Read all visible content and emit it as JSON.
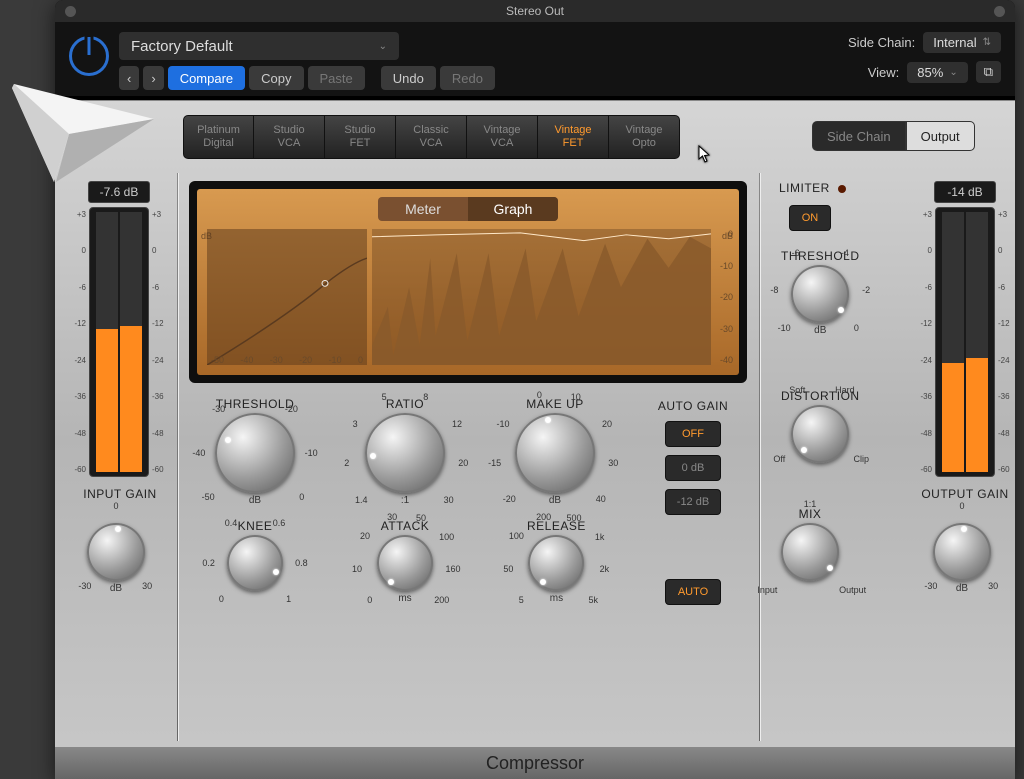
{
  "window": {
    "title": "Stereo Out"
  },
  "toolbar": {
    "preset": "Factory Default",
    "prev": "‹",
    "next": "›",
    "compare": "Compare",
    "copy": "Copy",
    "paste": "Paste",
    "undo": "Undo",
    "redo": "Redo",
    "sidechain_label": "Side Chain:",
    "sidechain_value": "Internal",
    "view_label": "View:",
    "view_value": "85%"
  },
  "model_tabs": [
    "Platinum Digital",
    "Studio VCA",
    "Studio FET",
    "Classic VCA",
    "Vintage VCA",
    "Vintage FET",
    "Vintage Opto"
  ],
  "model_active_index": 5,
  "panel_tabs": {
    "sidechain": "Side Chain",
    "output": "Output"
  },
  "input": {
    "value": "-7.6 dB",
    "marks": [
      "+3",
      "0",
      "-6",
      "-12",
      "-24",
      "-36",
      "-48",
      "-60"
    ],
    "fill_l": 55,
    "fill_r": 56,
    "label": "INPUT GAIN",
    "knob": {
      "min": "-30",
      "mid": "0",
      "max": "30",
      "unit": "dB"
    }
  },
  "output": {
    "value": "-14 dB",
    "marks": [
      "+3",
      "0",
      "-6",
      "-12",
      "-24",
      "-36",
      "-48",
      "-60"
    ],
    "fill_l": 42,
    "fill_r": 44,
    "label": "OUTPUT GAIN",
    "knob": {
      "min": "-30",
      "mid": "0",
      "max": "30",
      "unit": "dB"
    }
  },
  "screen": {
    "meter": "Meter",
    "graph": "Graph",
    "db": "dB",
    "y_ticks": [
      "0",
      "-10",
      "-20",
      "-30",
      "-40"
    ],
    "x_ticks": [
      "-50",
      "-40",
      "-30",
      "-20",
      "-10",
      "0"
    ]
  },
  "knobs": {
    "threshold": {
      "label": "THRESHOLD",
      "unit": "dB",
      "ticks": [
        "-50",
        "-40",
        "-30",
        "-20",
        "-10",
        "0"
      ]
    },
    "ratio": {
      "label": "RATIO",
      "unit": ":1",
      "ticks": [
        "1.4",
        "2",
        "3",
        "5",
        "8",
        "12",
        "20",
        "30"
      ]
    },
    "makeup": {
      "label": "MAKE UP",
      "unit": "dB",
      "ticks": [
        "-20",
        "-15",
        "-10",
        "0",
        "10",
        "20",
        "30",
        "40"
      ]
    },
    "knee": {
      "label": "KNEE",
      "unit": "",
      "ticks": [
        "0",
        "0.2",
        "0.4",
        "0.6",
        "0.8",
        "1"
      ]
    },
    "attack": {
      "label": "ATTACK",
      "unit": "ms",
      "ticks": [
        "0",
        "10",
        "20",
        "30",
        "50",
        "100",
        "160",
        "200"
      ]
    },
    "release": {
      "label": "RELEASE",
      "unit": "ms",
      "ticks": [
        "5",
        "50",
        "100",
        "200",
        "500",
        "1k",
        "2k",
        "5k"
      ]
    },
    "lim_thresh": {
      "label": "THRESHOLD",
      "unit": "dB",
      "ticks": [
        "-10",
        "-8",
        "-6",
        "-4",
        "-2",
        "0"
      ]
    },
    "distortion": {
      "label": "DISTORTION",
      "ticks": [
        "Off",
        "Soft",
        "Hard",
        "Clip"
      ]
    },
    "mix": {
      "label": "MIX",
      "ticks": [
        "Input",
        "1:1",
        "Output"
      ]
    }
  },
  "autogain": {
    "label": "AUTO GAIN",
    "off": "OFF",
    "zero": "0 dB",
    "minus12": "-12 dB",
    "auto": "AUTO"
  },
  "limiter": {
    "label": "LIMITER",
    "on": "ON"
  },
  "footer": "Compressor"
}
